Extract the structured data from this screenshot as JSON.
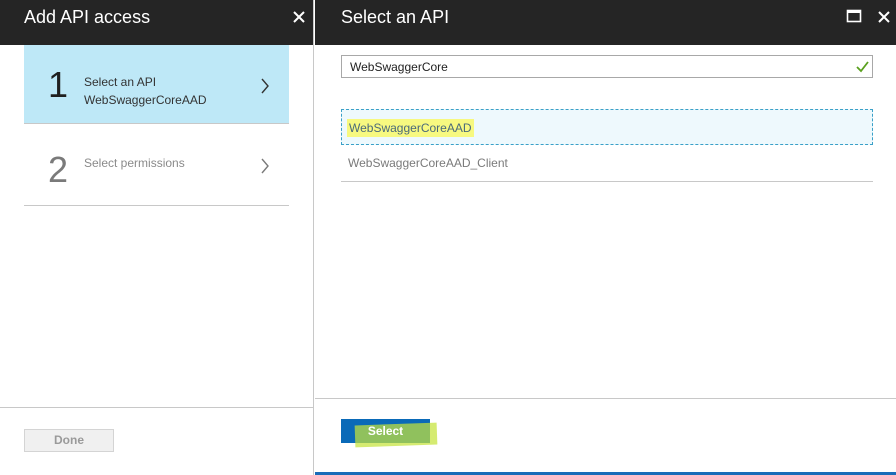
{
  "left_blade": {
    "title": "Add API access",
    "close_icon": "close-icon",
    "steps": [
      {
        "number": "1",
        "title": "Select an API",
        "subtitle": "WebSwaggerCoreAAD",
        "active": true
      },
      {
        "number": "2",
        "title": "Select permissions",
        "subtitle": "",
        "active": false
      }
    ],
    "done_label": "Done"
  },
  "right_blade": {
    "title": "Select an API",
    "maximize_icon": "maximize-icon",
    "close_icon": "close-icon",
    "search": {
      "value": "WebSwaggerCore",
      "valid_icon": "check-icon"
    },
    "results": [
      {
        "label": "WebSwaggerCoreAAD",
        "selected": true
      },
      {
        "label": "WebSwaggerCoreAAD_Client",
        "selected": false
      }
    ],
    "select_label": "Select"
  },
  "colors": {
    "header_bg": "#252525",
    "active_step_bg": "#bee8f7",
    "primary_button": "#0a6ab8",
    "highlight": "#f7f980",
    "check": "#5aa01e"
  }
}
